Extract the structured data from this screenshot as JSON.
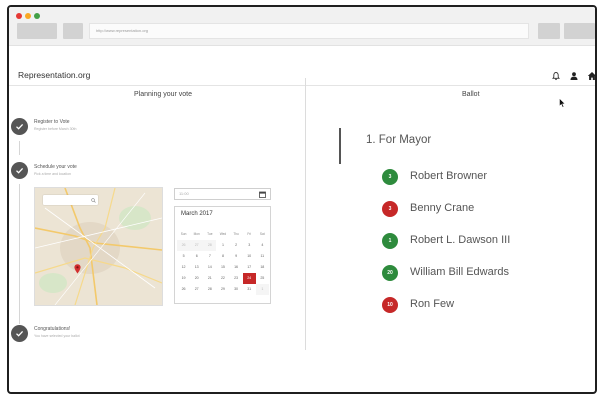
{
  "browser": {
    "url": "http://www.representation.org",
    "dot_colors": [
      "#e53935",
      "#f9a825",
      "#43a047"
    ]
  },
  "app": {
    "brand": "Representation.org",
    "icons": [
      "bell-icon",
      "user-icon",
      "home-icon"
    ]
  },
  "planning": {
    "title": "Planning your vote",
    "steps": [
      {
        "title": "Register to Vote",
        "subtitle": "Register before March 30th"
      },
      {
        "title": "Schedule your vote",
        "subtitle": "Pick a time and location"
      },
      {
        "title": "Congratulations!",
        "subtitle": "You have selected your ballot"
      }
    ],
    "time_value": "11:00",
    "calendar": {
      "month": "March 2017",
      "weekdays": [
        "Sun",
        "Mon",
        "Tue",
        "Wed",
        "Thu",
        "Fri",
        "Sat"
      ],
      "weeks": [
        [
          "26",
          "27",
          "28",
          "1",
          "2",
          "3",
          "4"
        ],
        [
          "5",
          "6",
          "7",
          "8",
          "9",
          "10",
          "11"
        ],
        [
          "12",
          "13",
          "14",
          "15",
          "16",
          "17",
          "18"
        ],
        [
          "19",
          "20",
          "21",
          "22",
          "23",
          "24",
          "25"
        ],
        [
          "26",
          "27",
          "28",
          "29",
          "30",
          "31",
          "1"
        ]
      ],
      "selected": "24"
    }
  },
  "ballot": {
    "title": "Ballot",
    "section": "1. For Mayor",
    "candidates": [
      {
        "name": "Robert Browner",
        "badge": "3",
        "color": "#2e8b3d"
      },
      {
        "name": "Benny Crane",
        "badge": "3",
        "color": "#c62828"
      },
      {
        "name": "Robert L. Dawson III",
        "badge": "1",
        "color": "#2e8b3d"
      },
      {
        "name": "William Bill Edwards",
        "badge": "20",
        "color": "#2e8b3d"
      },
      {
        "name": "Ron Few",
        "badge": "10",
        "color": "#c62828"
      }
    ]
  }
}
